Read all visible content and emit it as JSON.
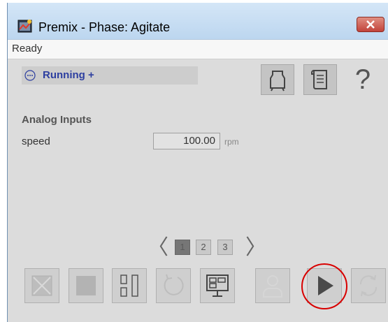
{
  "window": {
    "title": "Premix - Phase: Agitate",
    "status": "Ready",
    "icons": {
      "app": "faceplate-app-icon",
      "close": "close-icon"
    }
  },
  "state": {
    "text": "Running +",
    "icon": "state-ellipsis-icon"
  },
  "toolbar_top": [
    {
      "name": "equipment-tank-icon"
    },
    {
      "name": "recipe-scroll-icon"
    },
    {
      "name": "help-icon",
      "label": "?"
    }
  ],
  "analog_inputs": {
    "title": "Analog Inputs",
    "rows": [
      {
        "label": "speed",
        "value": "100.00",
        "unit": "rpm"
      }
    ]
  },
  "pager": {
    "prev": "〈",
    "next": "〉",
    "pages": [
      "1",
      "2",
      "3"
    ],
    "current": "1"
  },
  "commands": [
    {
      "name": "abort-icon",
      "enabled": false
    },
    {
      "name": "stop-icon",
      "enabled": false
    },
    {
      "name": "pause-icon",
      "enabled": true
    },
    {
      "name": "reset-icon",
      "enabled": false
    },
    {
      "name": "hmi-station-icon",
      "enabled": true
    },
    {
      "name": "acquire-operator-icon",
      "enabled": false
    },
    {
      "name": "start-play-icon",
      "enabled": true,
      "highlighted": true
    },
    {
      "name": "restart-icon",
      "enabled": false
    }
  ],
  "colors": {
    "state_text": "#2d3fa0",
    "highlight": "#d80000",
    "close_button": "#c2433a"
  }
}
